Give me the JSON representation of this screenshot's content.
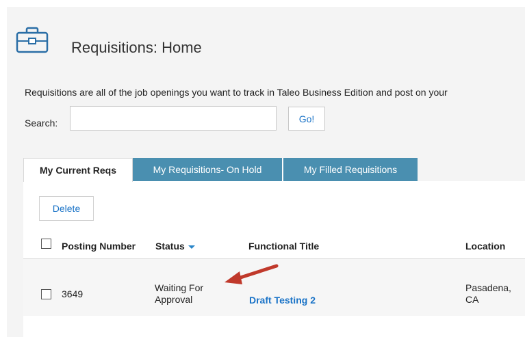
{
  "page": {
    "title": "Requisitions: Home",
    "description": "Requisitions are all of the job openings you want to track in Taleo Business Edition and post on your"
  },
  "search": {
    "label": "Search:",
    "value": "",
    "button_label": "Go!"
  },
  "tabs": [
    {
      "label": "My Current Reqs",
      "active": true
    },
    {
      "label": "My Requisitions- On Hold",
      "active": false
    },
    {
      "label": "My Filled Requisitions",
      "active": false
    }
  ],
  "toolbar": {
    "delete_label": "Delete"
  },
  "table": {
    "columns": [
      "Posting Number",
      "Status",
      "Functional Title",
      "Location"
    ],
    "sort_column": "Status",
    "rows": [
      {
        "checked": false,
        "posting_number": "3649",
        "status_line1": "Waiting For",
        "status_line2": "Approval",
        "functional_title": "Draft Testing 2",
        "location_line1": "Pasadena,",
        "location_line2": "CA"
      }
    ]
  },
  "icons": {
    "header": "briefcase-icon",
    "sort": "sort-down-icon",
    "annotation": "annotation-arrow-icon"
  },
  "colors": {
    "link": "#1a73c7",
    "tab_inactive_bg": "#4a8fb0",
    "annotation_arrow": "#c0392b",
    "header_icon": "#2a6ea6"
  }
}
